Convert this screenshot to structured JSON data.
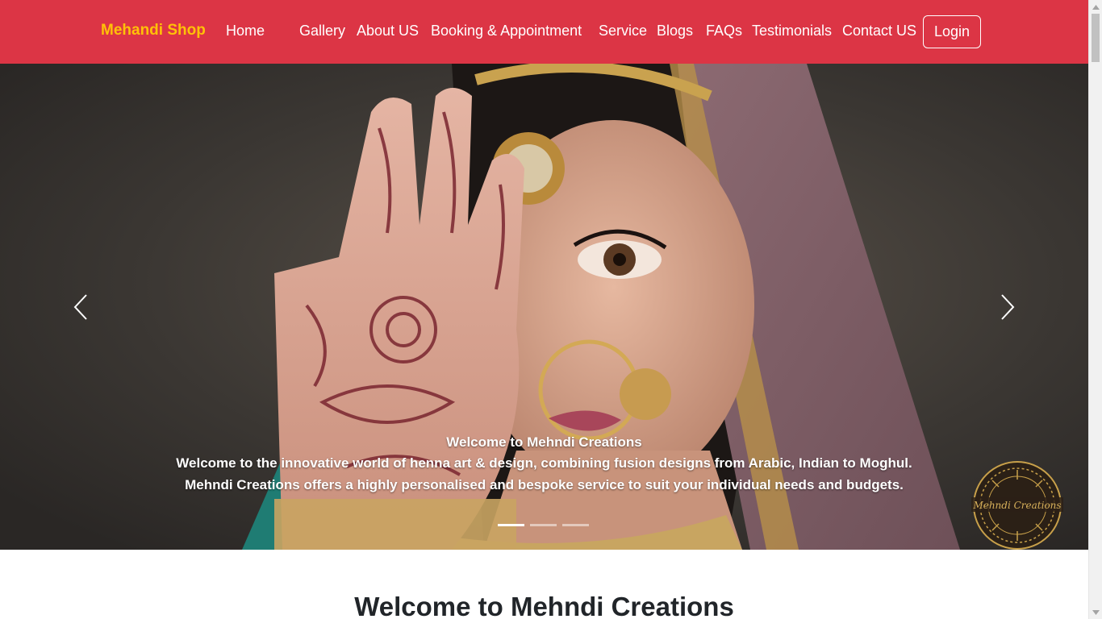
{
  "navbar": {
    "brand": "Mehandi Shop",
    "links": [
      "Home",
      "Gallery",
      "About US",
      "Booking & Appointment",
      "Service",
      "Blogs",
      "FAQs",
      "Testimonials",
      "Contact US"
    ],
    "login_label": "Login",
    "colors": {
      "background": "#dc3545",
      "brand": "#ffc107",
      "text": "#ffffff"
    }
  },
  "carousel": {
    "caption_title": "Welcome to Mehndi Creations",
    "caption_text": "Welcome to the innovative world of henna art & design, combining fusion designs from Arabic, Indian to Moghul. Mehndi Creations offers a highly personalised and bespoke service to suit your individual needs and budgets.",
    "slide_count": 3,
    "active_slide": 1,
    "prev_icon": "chevron-left-icon",
    "next_icon": "chevron-right-icon",
    "logo_text": "Mehndi Creations"
  },
  "main": {
    "section_title": "Welcome to Mehndi Creations"
  }
}
